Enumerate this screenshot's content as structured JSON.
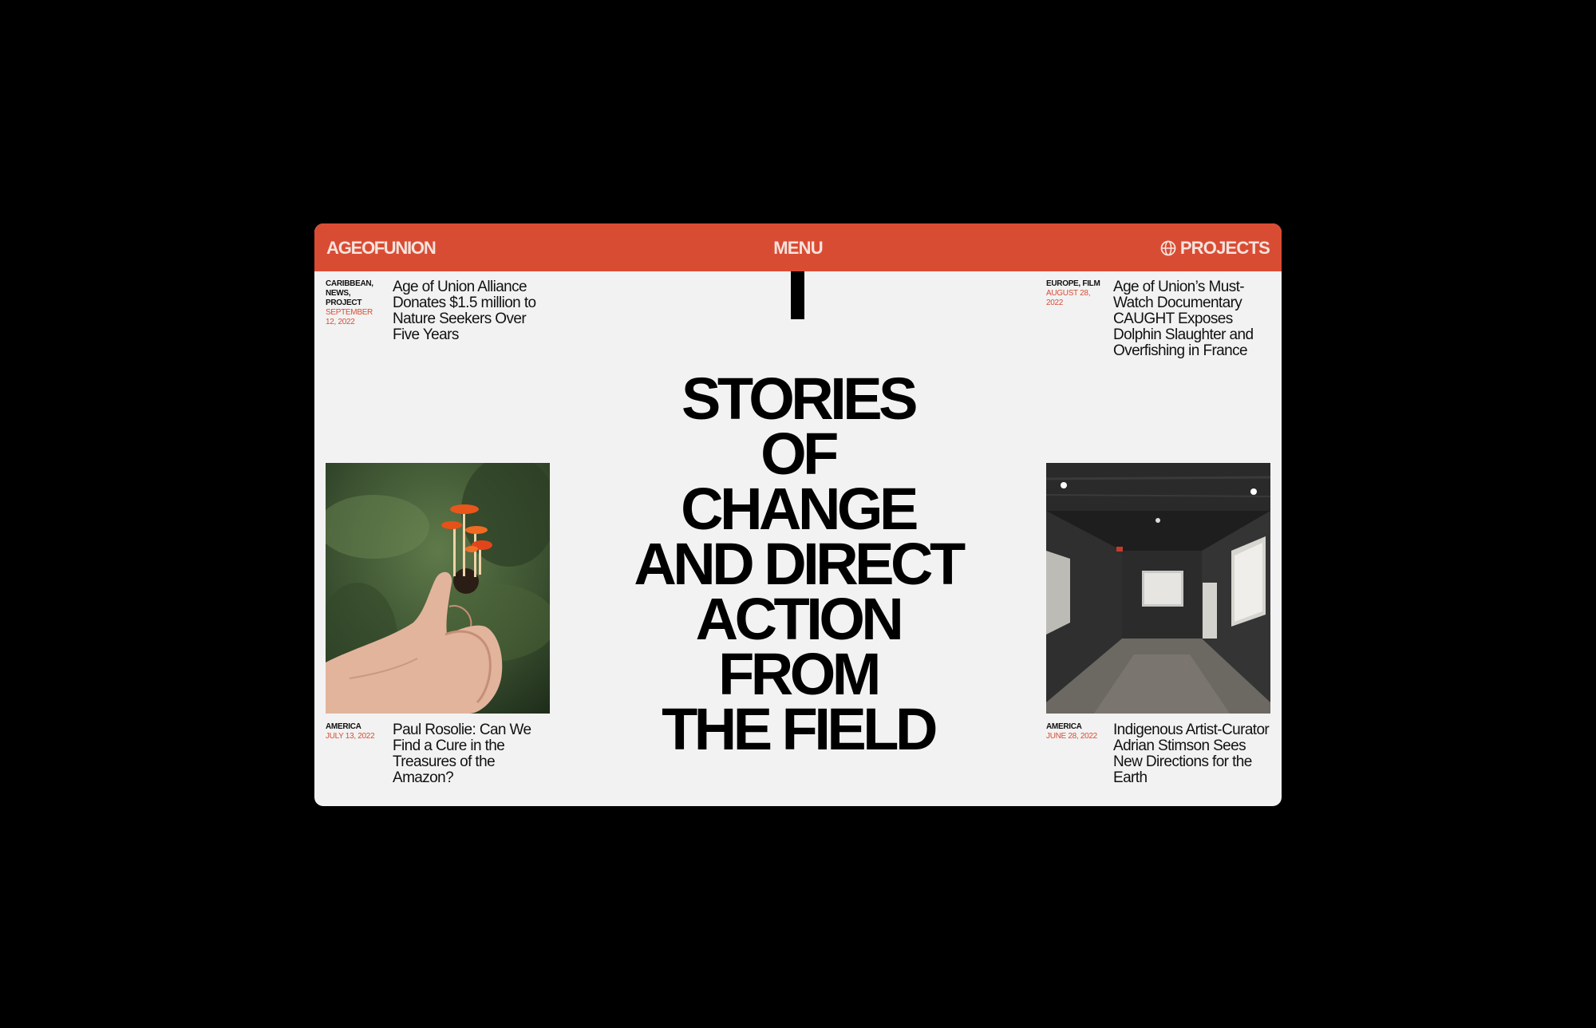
{
  "colors": {
    "accent": "#d94c34",
    "page_background": "#000000",
    "panel_background": "#f2f2f2",
    "text": "#111111"
  },
  "header": {
    "logo_part1": "AGE",
    "logo_part2": "OF",
    "logo_part3": "UNION",
    "menu_label": "MENU",
    "projects_label": "PROJECTS",
    "projects_icon": "globe-icon"
  },
  "hero": {
    "heading": "STORIES\nOF\nCHANGE\nAND DIRECT\nACTION\nFROM\nTHE FIELD"
  },
  "articles": [
    {
      "tags": "CARIBBEAN, NEWS, PROJECT",
      "date": "SEPTEMBER 12, 2022",
      "title": "Age of Union Alliance Donates $1.5 million to Nature Seekers Over Five Years"
    },
    {
      "tags": "EUROPE, FILM",
      "date": "AUGUST 28, 2022",
      "title": "Age of Union’s Must-Watch Documentary CAUGHT Exposes Dolphin Slaughter and Overfishing in France"
    },
    {
      "tags": "AMERICA",
      "date": "JULY 13, 2022",
      "title": "Paul Rosolie: Can We Find a Cure in the Treasures of the Amazon?"
    },
    {
      "tags": "AMERICA",
      "date": "JUNE 28, 2022",
      "title": "Indigenous Artist-Curator Adrian Stimson Sees New Directions for the Earth"
    }
  ]
}
